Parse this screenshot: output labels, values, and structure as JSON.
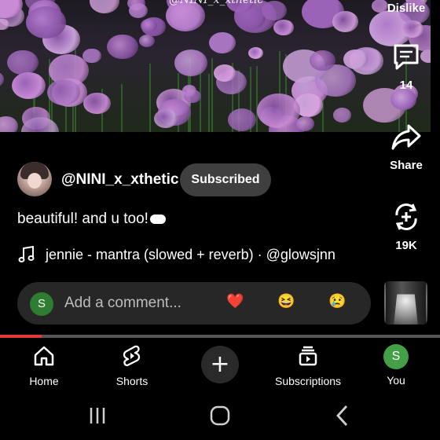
{
  "video": {
    "overlay_text": "@NINI_x_xthetic"
  },
  "actions": {
    "dislike_label": "Dislike",
    "comments_count": "14",
    "share_label": "Share",
    "remix_count": "19K"
  },
  "channel": {
    "name": "@NINI_x_xthetic",
    "subscribe_label": "Subscribed"
  },
  "caption": "beautiful! and u too!",
  "music": {
    "text": "jennie - mantra (slowed + reverb) · @glowsjnn"
  },
  "comment": {
    "avatar_letter": "S",
    "placeholder": "Add a comment...",
    "emojis": [
      "❤️",
      "😆",
      "😢"
    ]
  },
  "progress": {
    "played_fraction": 0.095
  },
  "bottom_nav": {
    "home": "Home",
    "shorts": "Shorts",
    "create": "+",
    "subscriptions": "Subscriptions",
    "you": "You",
    "you_avatar_letter": "S"
  },
  "colors": {
    "accent_red": "#e53935",
    "subscribed_bg": "#3f3f3f",
    "avatar_green": "#43a047"
  }
}
